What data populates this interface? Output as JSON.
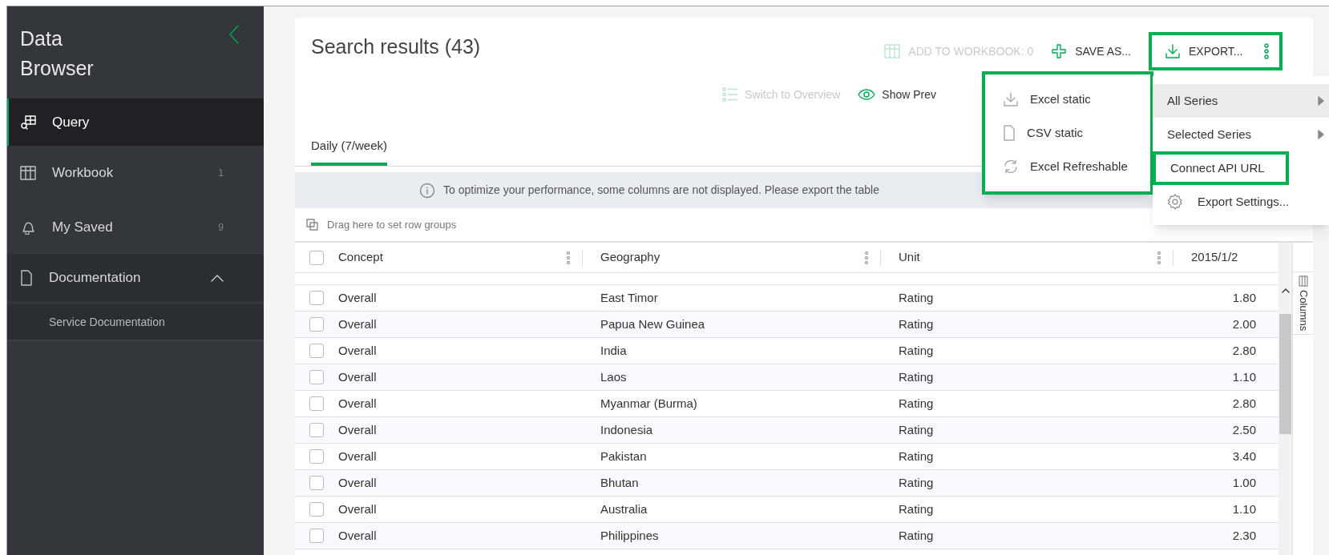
{
  "sidebar": {
    "title": "Data Browser",
    "items": [
      {
        "label": "Query",
        "kind": "query",
        "selected": true
      },
      {
        "label": "Workbook",
        "kind": "grid",
        "count": "1",
        "selected": false
      },
      {
        "label": "My Saved",
        "kind": "bell",
        "count": "9",
        "selected": false
      },
      {
        "label": "Documentation",
        "kind": "file",
        "selected": false,
        "expanded": true,
        "children": [
          {
            "label": "Service Documentation",
            "selected": false
          }
        ]
      }
    ]
  },
  "results": {
    "title": "Search results (43)",
    "toolbar": [
      {
        "kind": "grid",
        "label": "ADD TO WORKBOOK: 0",
        "disabled": true,
        "outlined": false
      },
      {
        "kind": "plus",
        "label": "SAVE AS...",
        "disabled": false,
        "outlined": false
      },
      {
        "kind": "download",
        "label": "EXPORT...",
        "disabled": false,
        "outlined": true
      }
    ],
    "view_actions": [
      {
        "kind": "list",
        "label": "Switch to Overview",
        "disabled": true
      },
      {
        "kind": "eye",
        "label": "Show Prev",
        "disabled": false
      }
    ],
    "tabs": [
      {
        "label": "Daily (7/week)",
        "selected": true
      }
    ],
    "banner": "To optimize your performance, some columns are not displayed. Please export the table",
    "group_hint": "Drag here to set row groups",
    "select_all_checked": false,
    "columns": [
      "Concept",
      "Geography",
      "Unit",
      "2015/1/2"
    ],
    "rows": [
      {
        "checked": false,
        "cells": [
          "Overall",
          "East Timor",
          "Rating",
          "1.80"
        ]
      },
      {
        "checked": false,
        "cells": [
          "Overall",
          "Papua New Guinea",
          "Rating",
          "2.00"
        ]
      },
      {
        "checked": false,
        "cells": [
          "Overall",
          "India",
          "Rating",
          "2.80"
        ]
      },
      {
        "checked": false,
        "cells": [
          "Overall",
          "Laos",
          "Rating",
          "1.10"
        ]
      },
      {
        "checked": false,
        "cells": [
          "Overall",
          "Myanmar (Burma)",
          "Rating",
          "2.80"
        ]
      },
      {
        "checked": false,
        "cells": [
          "Overall",
          "Indonesia",
          "Rating",
          "2.50"
        ]
      },
      {
        "checked": false,
        "cells": [
          "Overall",
          "Pakistan",
          "Rating",
          "3.40"
        ]
      },
      {
        "checked": false,
        "cells": [
          "Overall",
          "Bhutan",
          "Rating",
          "1.00"
        ]
      },
      {
        "checked": false,
        "cells": [
          "Overall",
          "Australia",
          "Rating",
          "1.10"
        ]
      },
      {
        "checked": false,
        "cells": [
          "Overall",
          "Philippines",
          "Rating",
          "2.30"
        ]
      }
    ],
    "side_panel": "Columns"
  },
  "export_menu": {
    "items": [
      {
        "kind": "submenu",
        "label": "All Series",
        "selected": true,
        "outlined": false
      },
      {
        "kind": "submenu",
        "label": "Selected Series",
        "selected": false,
        "outlined": false
      },
      {
        "kind": "plain",
        "label": "Connect API URL",
        "selected": false,
        "outlined": true
      },
      {
        "kind": "settings",
        "label": "Export Settings...",
        "selected": false,
        "outlined": false
      }
    ]
  },
  "export_submenu": {
    "outlined": true,
    "items": [
      {
        "kind": "download",
        "label": "Excel static"
      },
      {
        "kind": "file",
        "label": "CSV static"
      },
      {
        "kind": "refresh",
        "label": "Excel Refreshable"
      }
    ]
  }
}
